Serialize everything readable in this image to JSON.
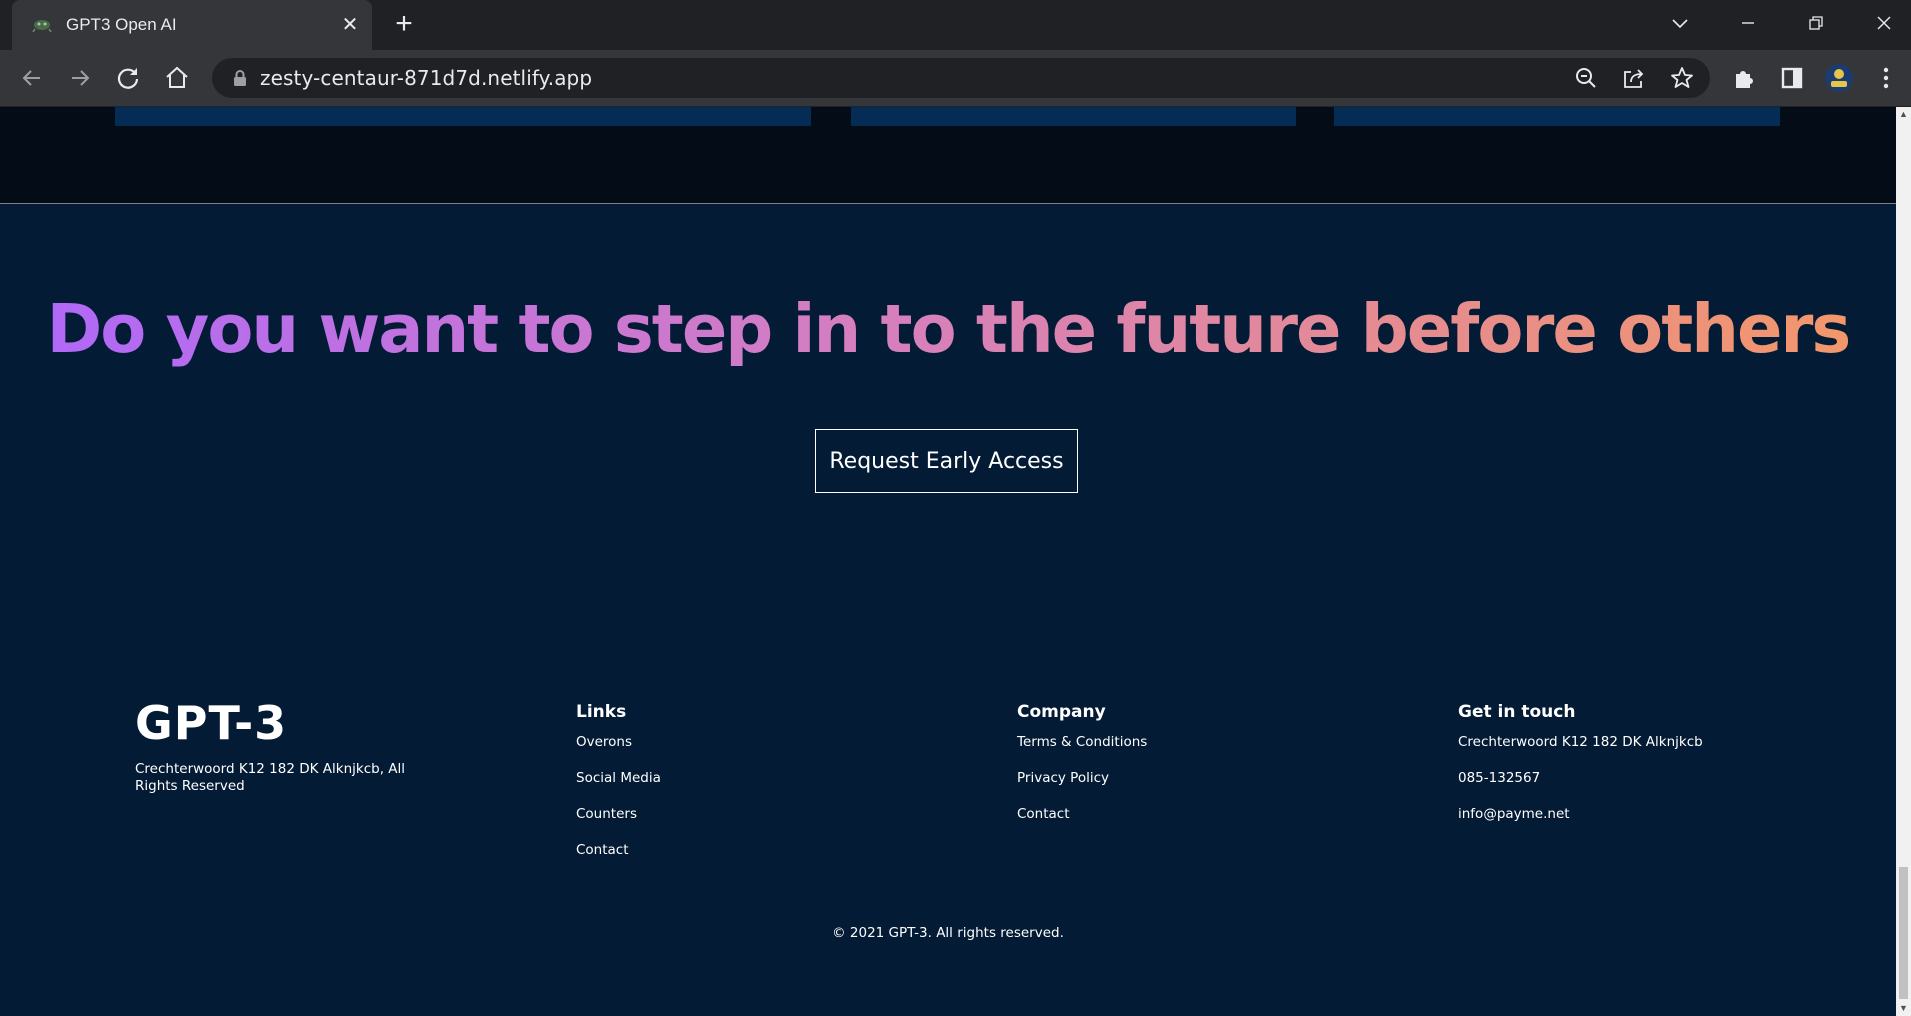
{
  "browser": {
    "tab_title": "GPT3 Open AI",
    "url": "zesty-centaur-871d7d.netlify.app",
    "tab_close_glyph": "✕",
    "new_tab_glyph": "+",
    "icons": [
      "back-arrow-icon",
      "forward-arrow-icon",
      "reload-icon",
      "home-icon",
      "lock-icon",
      "zoom-out-icon",
      "share-icon",
      "bookmark-star-icon",
      "extensions-puzzle-icon",
      "side-panel-icon",
      "profile-avatar-icon",
      "kebab-menu-icon"
    ]
  },
  "cta": {
    "title": "Do you want to step in to the future before others",
    "button_label": "Request Early Access",
    "gradient": [
      "#ae67fa",
      "#f49867"
    ]
  },
  "footer": {
    "logo": "GPT-3",
    "address": "Crechterwoord K12 182 DK Alknjkcb, All Rights Reserved",
    "columns": [
      {
        "heading": "Links",
        "items": [
          "Overons",
          "Social Media",
          "Counters",
          "Contact"
        ]
      },
      {
        "heading": "Company",
        "items": [
          "Terms & Conditions",
          "Privacy Policy",
          "Contact"
        ]
      },
      {
        "heading": "Get in touch",
        "items": [
          "Crechterwoord K12 182 DK Alknjkcb",
          "085-132567",
          "info@payme.net"
        ]
      }
    ],
    "copyright": "© 2021 GPT-3. All rights reserved."
  },
  "colors": {
    "page_bg": "#031b34",
    "top_section_bg": "#040c18",
    "card_bg": "#042c54",
    "chrome_bg": "#35363a"
  }
}
